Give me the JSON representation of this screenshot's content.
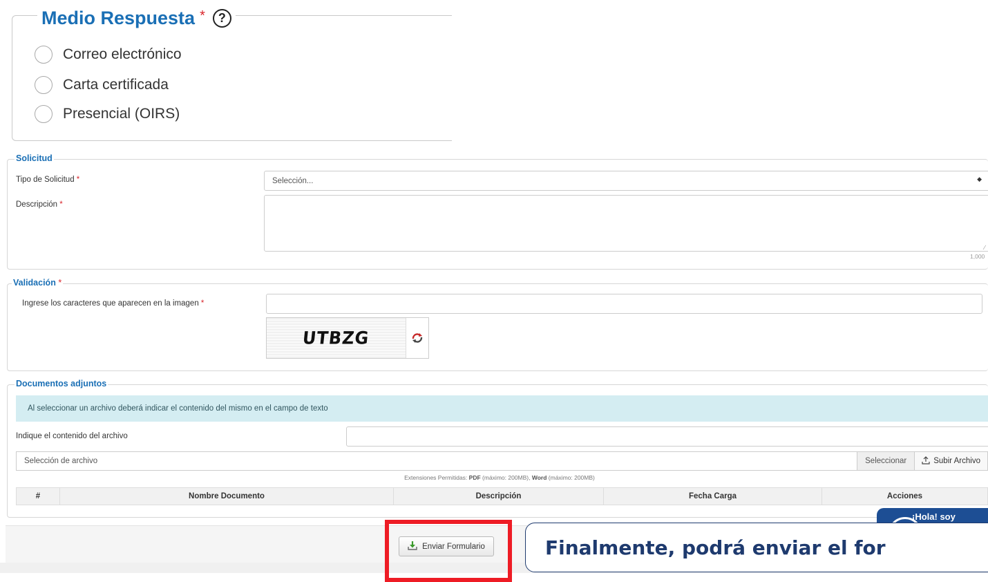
{
  "medio_respuesta": {
    "title": "Medio Respuesta",
    "required_mark": "*",
    "help_icon": "?",
    "options": [
      "Correo electrónico",
      "Carta certificada",
      "Presencial (OIRS)"
    ]
  },
  "solicitud": {
    "legend": "Solicitud",
    "tipo_label": "Tipo de Solicitud",
    "tipo_value": "Selección...",
    "descripcion_label": "Descripción",
    "descripcion_value": "",
    "char_limit": "1,000",
    "required_mark": "*"
  },
  "validacion": {
    "legend": "Validación",
    "required_mark": "*",
    "captcha_label": "Ingrese los caracteres que aparecen en la imagen",
    "captcha_input_value": "",
    "captcha_text": "UTBZG"
  },
  "documentos": {
    "legend": "Documentos adjuntos",
    "info_text": "Al seleccionar un archivo deberá indicar el contenido del mismo en el campo de texto",
    "contenido_label": "Indique el contenido del archivo",
    "contenido_value": "",
    "file_placeholder": "Selección de archivo",
    "select_button": "Seleccionar",
    "upload_button": "Subir Archivo",
    "ext_prefix": "Extensiones Permitidas:",
    "ext_pdf": "PDF",
    "ext_pdf_limit": "(máximo: 200MB),",
    "ext_word": "Word",
    "ext_word_limit": "(máximo: 200MB)",
    "columns": [
      "#",
      "Nombre Documento",
      "Descripción",
      "Fecha Carga",
      "Acciones"
    ]
  },
  "footer": {
    "send_button": "Enviar Formulario"
  },
  "chat": {
    "greeting": "¡Hola! soy "
  },
  "tooltip": {
    "text": "Finalmente, podrá enviar el for"
  },
  "colors": {
    "accent": "#1a6fb5",
    "required": "#d9262c",
    "highlight": "#ee1c25",
    "tooltip_border": "#1e3a6e",
    "chat_bg": "#1d4e94",
    "info_bg": "#d4edf2"
  }
}
